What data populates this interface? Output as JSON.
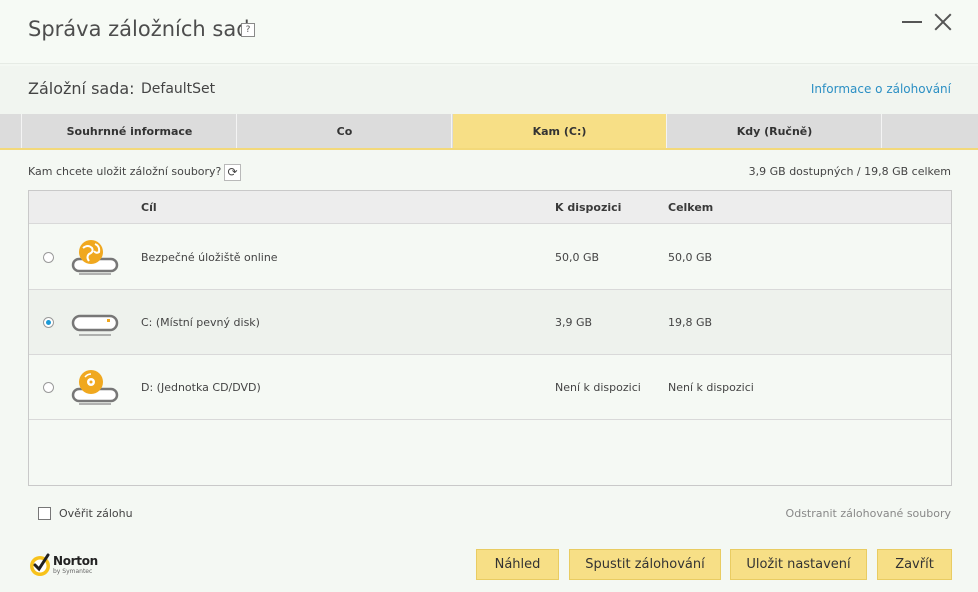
{
  "window": {
    "title": "Správa záložních sad",
    "help": "?"
  },
  "backup_set": {
    "label": "Záložní sada:",
    "value": "DefaultSet",
    "info_link": "Informace o zálohování"
  },
  "tabs": [
    {
      "label": "Souhrnné informace"
    },
    {
      "label": "Co"
    },
    {
      "label": "Kam (C:)"
    },
    {
      "label": "Kdy (Ručně)"
    }
  ],
  "destination": {
    "question": "Kam chcete uložit záložní soubory?",
    "space": "3,9 GB dostupných / 19,8 GB celkem",
    "columns": {
      "target": "Cíl",
      "available": "K dispozici",
      "total": "Celkem"
    },
    "rows": [
      {
        "name": "Bezpečné úložiště online",
        "available": "50,0 GB",
        "total": "50,0 GB",
        "icon": "online-storage-icon"
      },
      {
        "name": "C: (Místní pevný disk)",
        "available": "3,9 GB",
        "total": "19,8 GB",
        "icon": "hard-disk-icon"
      },
      {
        "name": "D: (Jednotka CD/DVD)",
        "available": "Není k dispozici",
        "total": "Není k dispozici",
        "icon": "cd-dvd-drive-icon"
      }
    ]
  },
  "options": {
    "verify_label": "Ověřit zálohu",
    "remove_link": "Odstranit zálohované soubory"
  },
  "brand": {
    "name": "Norton",
    "sub": "by Symantec"
  },
  "buttons": {
    "preview": "Náhled",
    "run": "Spustit zálohování",
    "save": "Uložit nastavení",
    "close": "Zavřít"
  },
  "colors": {
    "accent": "#f7df86",
    "link": "#2b8fc4",
    "radio_selected": "#1c9ad6",
    "icon_orange": "#f0a81f"
  }
}
